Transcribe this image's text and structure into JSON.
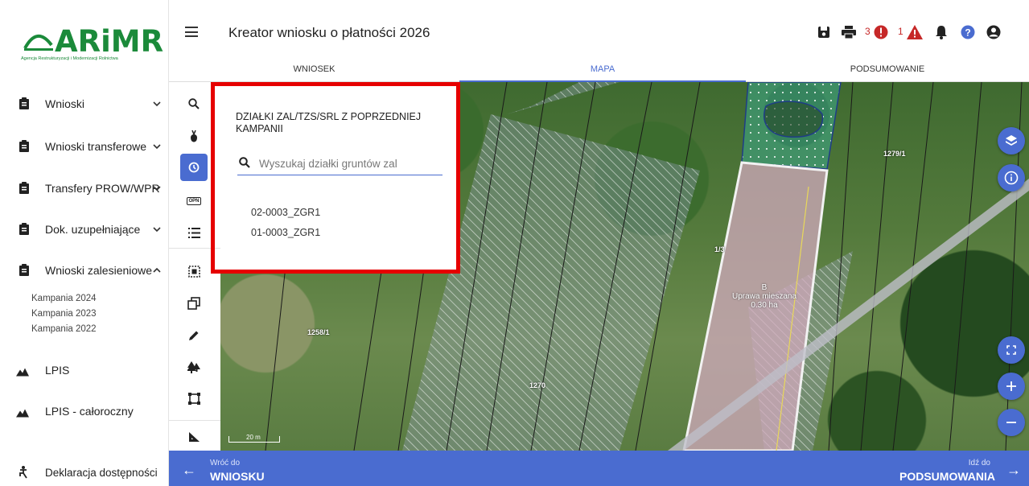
{
  "logo": {
    "word": "ARiMR",
    "subtitle": "Agencja Restrukturyzacji i Modernizacji Rolnictwa"
  },
  "sidebar": {
    "items": [
      {
        "label": "Wnioski",
        "expanded": false
      },
      {
        "label": "Wnioski transferowe",
        "expanded": false
      },
      {
        "label": "Transfery PROW/WPR",
        "expanded": false
      },
      {
        "label": "Dok. uzupełniające",
        "expanded": false
      },
      {
        "label": "Wnioski zalesieniowe",
        "expanded": true
      }
    ],
    "subitems": [
      "Kampania 2024",
      "Kampania 2023",
      "Kampania 2022"
    ],
    "lpis": "LPIS",
    "lpis_year": "LPIS - całoroczny",
    "accessibility": "Deklaracja dostępności"
  },
  "header": {
    "title": "Kreator wniosku o płatności 2026",
    "error_count": "3",
    "warning_count": "1",
    "tabs": [
      {
        "label": "WNIOSEK",
        "active": false
      },
      {
        "label": "MAPA",
        "active": true
      },
      {
        "label": "PODSUMOWANIE",
        "active": false
      }
    ]
  },
  "panel": {
    "title": "DZIAŁKI ZAL/TZS/SRL Z POPRZEDNIEJ KAMPANII",
    "search_placeholder": "Wyszukaj działki gruntów zal",
    "results": [
      "02-0003_ZGR1",
      "01-0003_ZGR1"
    ]
  },
  "map": {
    "labels": {
      "a": "1279/1",
      "b": "1258/1",
      "c": "1270",
      "d": "1/3"
    },
    "parcel": {
      "letter": "B",
      "crop": "Uprawa mieszana",
      "area": "0.30 ha"
    },
    "scale": "20 m"
  },
  "bottom": {
    "back_small": "Wróć do",
    "back_big": "WNIOSKU",
    "next_small": "Idź do",
    "next_big": "PODSUMOWANIA"
  },
  "colors": {
    "accent": "#4a6cd0",
    "brand": "#1b8a3a",
    "error": "#c62828",
    "highlight": "#e60000"
  }
}
